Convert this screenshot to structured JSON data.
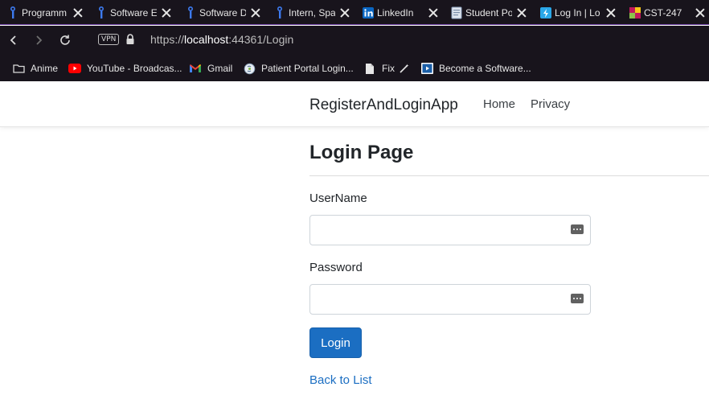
{
  "browser": {
    "tabs": [
      {
        "title": "Programm",
        "icon": "info-i-icon",
        "color": "#3d7bf0"
      },
      {
        "title": "Software E",
        "icon": "info-i-icon",
        "color": "#3d7bf0"
      },
      {
        "title": "Software D",
        "icon": "info-i-icon",
        "color": "#3d7bf0"
      },
      {
        "title": "Intern, Spa",
        "icon": "info-i-icon",
        "color": "#3d7bf0"
      },
      {
        "title": "LinkedIn",
        "icon": "linkedin-icon",
        "color": "#0a66c2"
      },
      {
        "title": "Student Po",
        "icon": "document-icon",
        "color": "#dfe6ef"
      },
      {
        "title": "Log In | Lo",
        "icon": "lightning-icon",
        "color": "#2aa7e8"
      },
      {
        "title": "CST-247",
        "icon": "grid-logo-icon",
        "color": "#c2185b"
      }
    ],
    "address": {
      "vpn_label": "VPN",
      "url_prefix": "https://",
      "url_host": "localhost",
      "url_rest": ":44361/Login"
    },
    "bookmarks": [
      {
        "label": "Anime",
        "icon": "folder-icon"
      },
      {
        "label": "YouTube - Broadcas...",
        "icon": "youtube-icon"
      },
      {
        "label": "Gmail",
        "icon": "gmail-icon"
      },
      {
        "label": "Patient Portal Login...",
        "icon": "portal-logo-icon"
      },
      {
        "label": "Fix",
        "icon": "file-icon"
      },
      {
        "label": "Become a Software...",
        "icon": "play-box-icon"
      }
    ]
  },
  "page": {
    "brand": "RegisterAndLoginApp",
    "nav": {
      "home": "Home",
      "privacy": "Privacy"
    },
    "heading": "Login Page",
    "form": {
      "username_label": "UserName",
      "username_value": "",
      "password_label": "Password",
      "password_value": "",
      "submit_label": "Login"
    },
    "back_link": "Back to List",
    "colors": {
      "primary": "#1b6ec2",
      "text": "#212529"
    }
  }
}
